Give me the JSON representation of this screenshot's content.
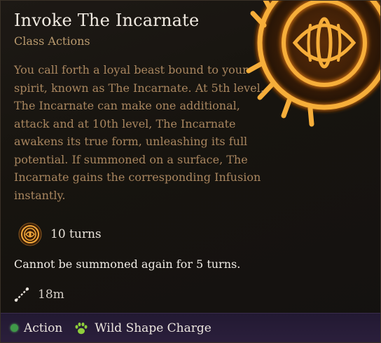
{
  "tooltip": {
    "title": "Invoke The Incarnate",
    "subtitle": "Class Actions",
    "description": "You call forth a loyal beast bound to your spirit, known as The Incarnate. At 5th level, The Incarnate can make one additional, attack and at 10th level, The Incarnate awakens its true form, unleashing its full potential. If summoned on a surface, The Incarnate gains the corresponding Infusion instantly.",
    "duration": "10 turns",
    "cooldown_text": "Cannot be summoned again for 5 turns.",
    "range": "18m",
    "footer": {
      "action_label": "Action",
      "resource_label": "Wild Shape Charge"
    }
  },
  "icons": {
    "emblem": "glowing-eye-emblem-icon",
    "duration": "eye-emblem-icon",
    "range": "range-ruler-icon",
    "action": "action-dot-icon",
    "resource": "paw-print-icon"
  },
  "colors": {
    "background": "#17140f",
    "title": "#f1ebe2",
    "subtitle": "#b99a6e",
    "description": "#a9865f",
    "footer": "#2b1f3c",
    "action_dot": "#3f9a48",
    "emblem_glow": "#f4a531"
  }
}
